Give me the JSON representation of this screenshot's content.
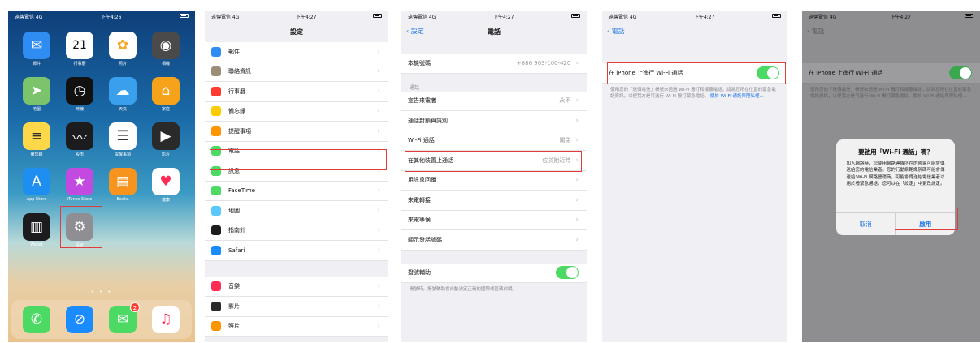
{
  "status_common": {
    "time_1": "下午4:26",
    "time_2": "下午4:27",
    "carrier_1": "遠傳電信 4G",
    "carrier_2": "遠傳電信 4G"
  },
  "home": {
    "apps": [
      {
        "label": "郵件",
        "icon": "mail-icon",
        "color": "#2f8cf3"
      },
      {
        "label": "行事曆",
        "icon": "calendar-icon",
        "color": "#ffffff",
        "date": "21"
      },
      {
        "label": "照片",
        "icon": "photos-icon",
        "color": "#ffffff"
      },
      {
        "label": "相機",
        "icon": "camera-icon",
        "color": "#4a4a4a"
      },
      {
        "label": "地圖",
        "icon": "maps-icon",
        "color": "#7bc46b"
      },
      {
        "label": "時鐘",
        "icon": "clock-icon",
        "color": "#111111"
      },
      {
        "label": "天氣",
        "icon": "weather-icon",
        "color": "#3aa0ee"
      },
      {
        "label": "家庭",
        "icon": "home-icon",
        "color": "#f6a31b"
      },
      {
        "label": "備忘錄",
        "icon": "notes-icon",
        "color": "#ffd84a"
      },
      {
        "label": "股市",
        "icon": "stocks-icon",
        "color": "#1c1c1e"
      },
      {
        "label": "提醒事項",
        "icon": "reminders-icon",
        "color": "#ffffff"
      },
      {
        "label": "影片",
        "icon": "videos-icon",
        "color": "#2a2a2a"
      },
      {
        "label": "App Store",
        "icon": "appstore-icon",
        "color": "#1f8ef1"
      },
      {
        "label": "iTunes Store",
        "icon": "itunes-icon",
        "color": "#c24ae0"
      },
      {
        "label": "Books",
        "icon": "books-icon",
        "color": "#f7941d"
      },
      {
        "label": "健康",
        "icon": "health-icon",
        "color": "#ffffff"
      },
      {
        "label": "Wallet",
        "icon": "wallet-icon",
        "color": "#1c1c1e"
      },
      {
        "label": "設定",
        "icon": "settings-icon",
        "color": "#8e8e93"
      }
    ],
    "dock": [
      {
        "icon": "phone-icon",
        "color": "#4cd964"
      },
      {
        "icon": "safari-icon",
        "color": "#1a8cff"
      },
      {
        "icon": "messages-icon",
        "color": "#4cd964",
        "badge": "2"
      },
      {
        "icon": "music-icon",
        "color": "#ffffff"
      }
    ]
  },
  "settings": {
    "title": "設定",
    "rows": [
      {
        "label": "郵件",
        "color": "#2f8cf3"
      },
      {
        "label": "聯絡資訊",
        "color": "#9b8d76"
      },
      {
        "label": "行事曆",
        "color": "#ff3b30"
      },
      {
        "label": "備忘錄",
        "color": "#ffcc00"
      },
      {
        "label": "提醒事項",
        "color": "#ff9500"
      },
      {
        "label": "電話",
        "color": "#4cd964"
      },
      {
        "label": "訊息",
        "color": "#4cd964"
      },
      {
        "label": "FaceTime",
        "color": "#4cd964"
      },
      {
        "label": "地圖",
        "color": "#5ac8fa"
      },
      {
        "label": "指南針",
        "color": "#1c1c1e"
      },
      {
        "label": "Safari",
        "color": "#1a8cff"
      }
    ],
    "rows2": [
      {
        "label": "音樂",
        "color": "#ff2d55"
      },
      {
        "label": "影片",
        "color": "#2a2a2a"
      },
      {
        "label": "照片",
        "color": "#ff9500"
      }
    ]
  },
  "phone": {
    "back": "設定",
    "title": "電話",
    "my_number_label": "本機號碼",
    "my_number_value": "+886 903-100-420",
    "section": "通話",
    "rows": [
      {
        "label": "宣告來電者",
        "value": "永不"
      },
      {
        "label": "通話封鎖與識別",
        "value": ""
      },
      {
        "label": "Wi-Fi 通話",
        "value": "關閉"
      },
      {
        "label": "在其他裝置上通話",
        "value": "位於附近時"
      },
      {
        "label": "用訊息回覆",
        "value": ""
      },
      {
        "label": "來電轉接",
        "value": ""
      },
      {
        "label": "來電等候",
        "value": ""
      },
      {
        "label": "顯示發話號碼",
        "value": ""
      }
    ],
    "dial_assist_label": "撥號輔助",
    "dial_assist_note": "撥號時，撥號輔助會自動決定正確的國際或區碼前綴。"
  },
  "wifi_calling": {
    "back": "電話",
    "toggle_label": "在 iPhone 上進行 Wi-Fi 通話",
    "note": "使用您的「遠傳電信」帳號來透過 Wi-Fi 撥打和接聽電話，請將您所在位置的緊急電話資訊，以便我方是可進行 Wi-Fi 撥打緊急電話。",
    "note_link": "關於 Wi-Fi 通話與隱私權…"
  },
  "alert": {
    "back": "電話",
    "toggle_label": "在 iPhone 上進行 Wi-Fi 通話",
    "note": "使用您的「遠傳電信」帳號來透過 Wi-Fi 撥打和接聽電話，請將您所在位置的緊急電話資訊，以便我方是可進行 Wi-Fi 撥打緊急電話。關於 Wi-Fi 通話與隱私權…",
    "title": "要啟用「Wi-Fi 通話」嗎？",
    "message": "加入網路時，您使用網路連線所在的國家可能會傳送給您的電信業者。您的行動網路識別碼可能會傳送給 Wi-Fi 網路營運商。可能會傳送給電信業者以用於撥緊急通話。您可以在「設定」中更改設定。",
    "cancel": "取消",
    "enable": "啟用"
  }
}
